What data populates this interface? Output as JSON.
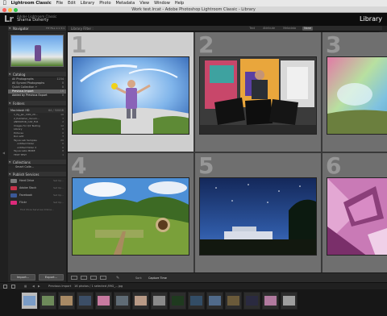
{
  "menubar": {
    "app": "Lightroom Classic",
    "items": [
      "File",
      "Edit",
      "Library",
      "Photo",
      "Metadata",
      "View",
      "Window",
      "Help"
    ]
  },
  "window": {
    "title": "Work test.lrcat - Adobe Photoshop Lightroom Classic - Library"
  },
  "identity": {
    "logo": "Lr",
    "product": "Adobe Lightroom Classic",
    "user": "Sharna Doherty"
  },
  "module": "Library",
  "navigator": {
    "title": "Navigator",
    "tools": "FIT  FILL  1:1  3:1"
  },
  "catalog": {
    "title": "Catalog",
    "items": [
      {
        "label": "All Photographs",
        "count": "1234"
      },
      {
        "label": "All Synced Photographs",
        "count": "0"
      },
      {
        "label": "Quick Collection +",
        "count": "0"
      },
      {
        "label": "Previous Import",
        "count": "16"
      },
      {
        "label": "Added by Previous Export",
        "count": "0"
      }
    ]
  },
  "folders": {
    "title": "Folders",
    "volume": "Macintosh HD",
    "volume_size": "64 / 500GB",
    "items": [
      {
        "label": "1_Pg_Jan_CON_20...",
        "count": "16"
      },
      {
        "label": "2_Publisher_docum...",
        "count": "7"
      },
      {
        "label": "ANIMATOR_CAP_FLR",
        "count": "2"
      },
      {
        "label": "Images for Q4 Testing",
        "count": "12"
      },
      {
        "label": "Library",
        "count": "0"
      },
      {
        "label": "Pictures",
        "count": "0"
      },
      {
        "label": "Run edit",
        "count": "3"
      },
      {
        "label": "Tayua Lab Samples",
        "count": "20"
      },
      {
        "label": "untitled folder",
        "count": "0"
      },
      {
        "label": "untitled folder 2",
        "count": "0"
      },
      {
        "label": "Tayua Labs MORE",
        "count": "8"
      },
      {
        "label": "TEXT TEST",
        "count": "1"
      }
    ]
  },
  "collections": {
    "title": "Collections",
    "items": [
      {
        "label": "Smart Colle...",
        "count": ""
      }
    ]
  },
  "publish": {
    "title": "Publish Services",
    "items": [
      {
        "label": "Hard Drive",
        "action": "Set Up...",
        "color": "#7a7a7a"
      },
      {
        "label": "Adobe Stock",
        "action": "Set Up...",
        "color": "#c8324a"
      },
      {
        "label": "Facebook",
        "action": "Set Up...",
        "color": "#3b5998"
      },
      {
        "label": "Flickr",
        "action": "Set Up...",
        "color": "#dd2a7b"
      }
    ],
    "find_more": "Find More Services Online..."
  },
  "buttons": {
    "import": "Import...",
    "export": "Export..."
  },
  "grid": {
    "filter_title": "Library Filter :",
    "filter_tabs": [
      "Text",
      "Attribute",
      "Metadata",
      "None"
    ],
    "filter_active": "None",
    "cells": [
      {
        "num": "1",
        "selected": true,
        "photo": "fisheye-selfie"
      },
      {
        "num": "2",
        "selected": false,
        "photo": "graffiti-vinyl"
      },
      {
        "num": "3",
        "selected": false,
        "photo": "colour-coast"
      },
      {
        "num": "4",
        "selected": false,
        "photo": "hobbit-hole"
      },
      {
        "num": "5",
        "selected": false,
        "photo": "night-sky"
      },
      {
        "num": "6",
        "selected": false,
        "photo": "pink-butterfly"
      }
    ]
  },
  "toolbar": {
    "sort_label": "Sort:",
    "sort_value": "Capture Time"
  },
  "filmstrip": {
    "source": "Previous Import",
    "status": "16 photos / 1 selected /IMG_...jpg",
    "thumbs": [
      "#7a9cc6",
      "#6d8a5a",
      "#a88a65",
      "#3c4e66",
      "#c77aa0",
      "#5f6b75",
      "#b89a86",
      "#8a8a8a",
      "#1f3a1f",
      "#334d66",
      "#506a8a",
      "#6a5a3a",
      "#2a2a40",
      "#b17a9f",
      "#9e9e9e"
    ]
  }
}
